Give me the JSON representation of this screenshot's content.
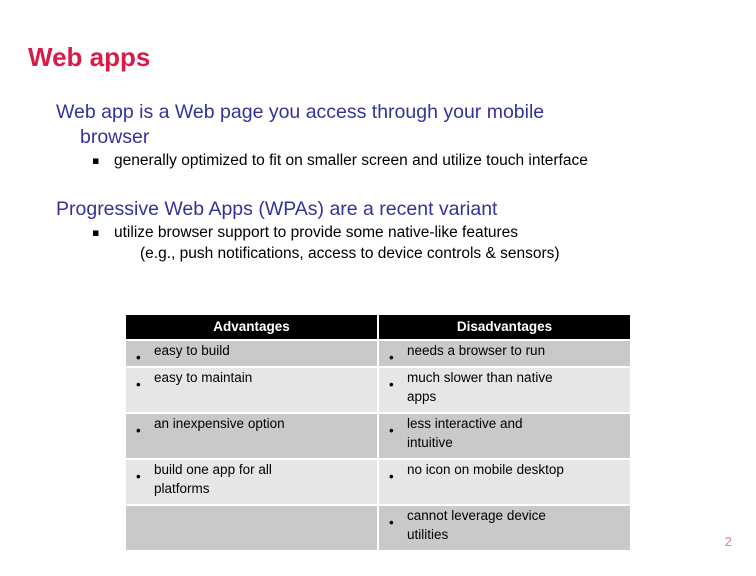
{
  "slide": {
    "title": "Web apps",
    "page_number": "2",
    "title_color": "#d81b48",
    "heading_color": "#333399",
    "header_bg": "#000000",
    "row_dark": "#c9c9c9",
    "row_light": "#e6e6e6"
  },
  "blocks": [
    {
      "heading_line1": "Web app is a Web page you access through your mobile",
      "heading_line2": "browser",
      "sub_bullet_marker": "▪",
      "sub_bullet_line1": "generally optimized to fit on smaller screen and utilize touch interface",
      "sub_bullet_line2": ""
    },
    {
      "heading_line1": "Progressive Web Apps (WPAs) are a recent variant",
      "heading_line2": "",
      "sub_bullet_marker": "▪",
      "sub_bullet_line1": "utilize browser support to provide some native-like features",
      "sub_bullet_line2": "(e.g., push notifications, access to device controls & sensors)"
    }
  ],
  "table": {
    "headers": [
      "Advantages",
      "Disadvantages"
    ],
    "bullet": "•",
    "rows": [
      {
        "shade": "dark",
        "left": {
          "bullet": "•",
          "line1": "easy to build",
          "line2": ""
        },
        "right": {
          "bullet": "•",
          "line1": "needs a browser to run",
          "line2": ""
        }
      },
      {
        "shade": "light",
        "left": {
          "bullet": "•",
          "line1": "easy to maintain",
          "line2": ""
        },
        "right": {
          "bullet": "•",
          "line1": "much slower than native",
          "line2": "apps"
        }
      },
      {
        "shade": "dark",
        "left": {
          "bullet": "•",
          "line1": "an inexpensive option",
          "line2": ""
        },
        "right": {
          "bullet": "•",
          "line1": "less interactive and",
          "line2": "intuitive"
        }
      },
      {
        "shade": "light",
        "left": {
          "bullet": "•",
          "line1": "build one app for all",
          "line2": "platforms"
        },
        "right": {
          "bullet": "•",
          "line1": "no icon on mobile desktop",
          "line2": ""
        }
      },
      {
        "shade": "dark",
        "left": {
          "bullet": "",
          "line1": "",
          "line2": ""
        },
        "right": {
          "bullet": "•",
          "line1": "cannot leverage device",
          "line2": "utilities"
        }
      }
    ]
  }
}
